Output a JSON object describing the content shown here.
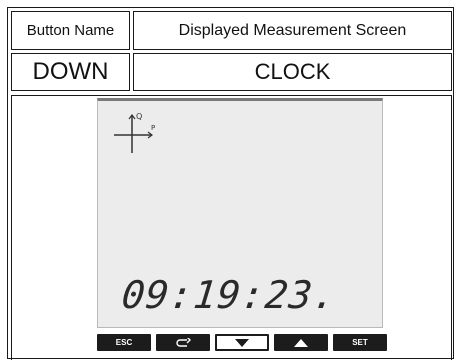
{
  "table": {
    "header_button": "Button Name",
    "header_display": "Displayed Measurement Screen",
    "button_value": "DOWN",
    "display_value": "CLOCK"
  },
  "lcd": {
    "time": "09:19:23.",
    "quadrant_labels": {
      "q": "Q",
      "p": "P"
    }
  },
  "keys": [
    {
      "label": "ESC",
      "icon": null
    },
    {
      "label": "",
      "icon": "return-arrow-icon"
    },
    {
      "label": "",
      "icon": "down-triangle-icon"
    },
    {
      "label": "",
      "icon": "up-triangle-icon"
    },
    {
      "label": "SET",
      "icon": null
    }
  ],
  "colors": {
    "lcd_background": "#ececec",
    "key_background": "#1c1c1c"
  }
}
